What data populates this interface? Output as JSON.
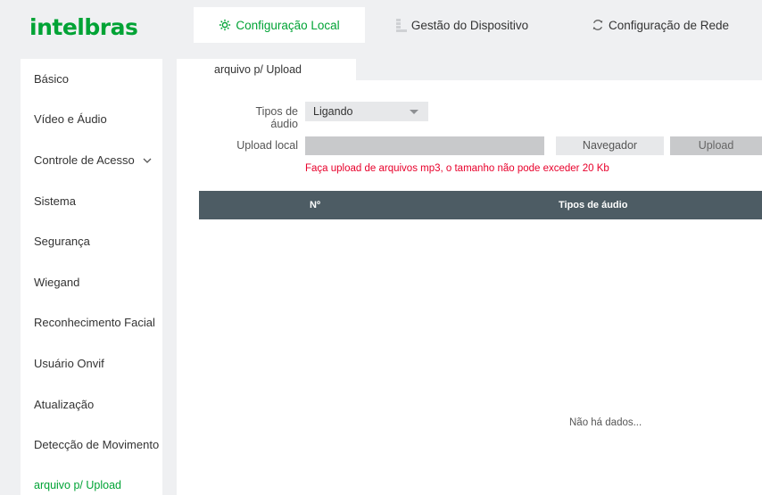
{
  "brand": {
    "logo_text": "intelbras",
    "accent_color": "#00a335"
  },
  "top_tabs": [
    {
      "label": "Configuração Local",
      "icon": "gear-icon",
      "active": true
    },
    {
      "label": "Gestão do Dispositivo",
      "icon": "device-list-icon",
      "active": false
    },
    {
      "label": "Configuração de Rede",
      "icon": "network-refresh-icon",
      "active": false
    }
  ],
  "sidebar": {
    "items": [
      {
        "label": "Básico"
      },
      {
        "label": "Vídeo e Áudio"
      },
      {
        "label": "Controle de Acesso",
        "icon": "chevron-down-icon"
      },
      {
        "label": "Sistema"
      },
      {
        "label": "Segurança"
      },
      {
        "label": "Wiegand"
      },
      {
        "label": "Reconhecimento Facial"
      },
      {
        "label": "Usuário Onvif"
      },
      {
        "label": "Atualização"
      },
      {
        "label": "Detecção de Movimento"
      },
      {
        "label": "arquivo p/ Upload",
        "active": true
      }
    ]
  },
  "main": {
    "subtab": "arquivo p/ Upload",
    "audio_type_label": "Tipos de áudio",
    "audio_type_value": "Ligando",
    "upload_label": "Upload local",
    "upload_value": "",
    "browse_button": "Navegador",
    "upload_button": "Upload",
    "hint": "Faça upload de arquivos mp3, o tamanho não pode exceder 20 Kb",
    "hint_color": "#e8002b",
    "table": {
      "columns": [
        "Nº",
        "Tipos de áudio"
      ],
      "header_color": "#4d5c64",
      "rows": [],
      "empty_text": "Não há dados..."
    }
  }
}
